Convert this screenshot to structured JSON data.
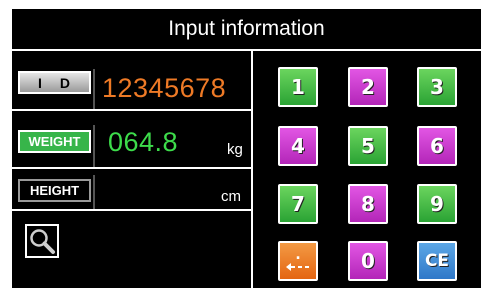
{
  "title": "Input information",
  "fields": {
    "id": {
      "label": "I D",
      "value": "12345678",
      "color": "#ee7a26"
    },
    "weight": {
      "label": "WEIGHT",
      "value": "064.8",
      "unit": "kg",
      "color": "#3ddc4b"
    },
    "height": {
      "label": "HEIGHT",
      "value": "",
      "unit": "cm"
    }
  },
  "search": {
    "icon": "magnifier-icon"
  },
  "keypad": {
    "keys": [
      "1",
      "2",
      "3",
      "4",
      "5",
      "6",
      "7",
      "8",
      "9",
      "",
      "0",
      "CE"
    ],
    "backspace_label": ".",
    "colors": {
      "green": "#2aa334",
      "magenta": "#b326b8",
      "orange": "#e46512",
      "blue": "#2f78c8"
    }
  }
}
